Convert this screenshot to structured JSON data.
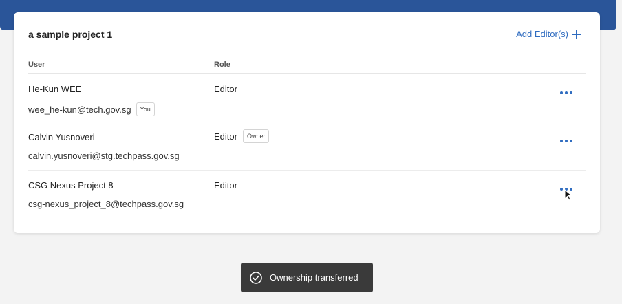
{
  "project": {
    "title": "a sample project 1",
    "add_editor_label": "Add Editor(s)"
  },
  "table": {
    "headers": {
      "user": "User",
      "role": "Role"
    },
    "rows": [
      {
        "name": "He-Kun WEE",
        "email": "wee_he-kun@tech.gov.sg",
        "email_badge": "You",
        "role": "Editor",
        "role_badge": ""
      },
      {
        "name": "Calvin Yusnoveri",
        "email": "calvin.yusnoveri@stg.techpass.gov.sg",
        "email_badge": "",
        "role": "Editor",
        "role_badge": "Owner"
      },
      {
        "name": "CSG Nexus Project 8",
        "email": "csg-nexus_project_8@techpass.gov.sg",
        "email_badge": "",
        "role": "Editor",
        "role_badge": ""
      }
    ]
  },
  "toast": {
    "message": "Ownership transferred"
  },
  "colors": {
    "banner": "#2a5599",
    "accent": "#2f6cc0",
    "toast_bg": "#3a3a3a"
  },
  "icons": {
    "add": "plus-icon",
    "more": "more-options-icon",
    "toast": "check-circle-icon",
    "cursor": "mouse-cursor-icon"
  }
}
